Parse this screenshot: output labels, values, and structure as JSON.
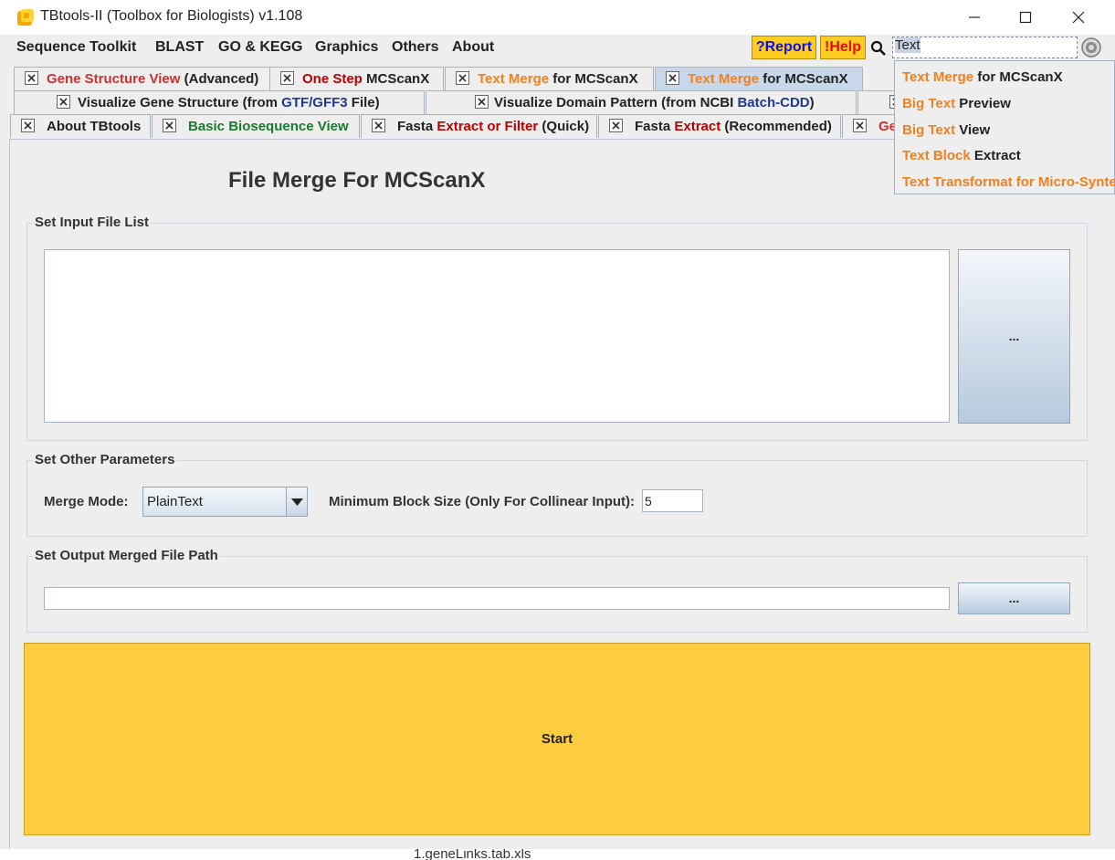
{
  "window": {
    "title": "TBtools-II (Toolbox for Biologists) v1.108"
  },
  "menu": {
    "items": [
      "Sequence Toolkit",
      "BLAST",
      "GO & KEGG",
      "Graphics",
      "Others",
      "About"
    ],
    "report_label": "?Report",
    "help_label": "!Help"
  },
  "search": {
    "value": "Text"
  },
  "tabs": {
    "row1": [
      {
        "parts": [
          [
            "Gene Structure View",
            "red"
          ],
          [
            " (Advanced)",
            "black"
          ]
        ]
      },
      {
        "parts": [
          [
            "One Step",
            "darkred"
          ],
          [
            " MCScanX",
            "black"
          ]
        ]
      },
      {
        "parts": [
          [
            "Text Merge",
            "orange"
          ],
          [
            " for MCScanX",
            "black"
          ]
        ]
      },
      {
        "parts": [
          [
            "Text Merge",
            "orange"
          ],
          [
            " for MCScanX",
            "black"
          ]
        ],
        "selected": true
      }
    ],
    "row2": [
      {
        "parts": [
          [
            "Visualize Gene Structure (from ",
            "black"
          ],
          [
            "GTF/GFF3",
            "blue"
          ],
          [
            " File)",
            "black"
          ]
        ]
      },
      {
        "parts": [
          [
            "Visualize Domain Pattern (from NCBI ",
            "black"
          ],
          [
            "Batch-CDD",
            "blue"
          ],
          [
            ")",
            "black"
          ]
        ]
      }
    ],
    "row3": [
      {
        "parts": [
          [
            "About TBtools",
            "black"
          ]
        ]
      },
      {
        "parts": [
          [
            "Basic Biosequence View",
            "green"
          ]
        ]
      },
      {
        "parts": [
          [
            "Fasta ",
            "black"
          ],
          [
            "Extract or Filter",
            "darkred"
          ],
          [
            " (Quick)",
            "black"
          ]
        ]
      },
      {
        "parts": [
          [
            "Fasta ",
            "black"
          ],
          [
            "Extract",
            "darkred"
          ],
          [
            " (Recommended)",
            "black"
          ]
        ]
      },
      {
        "parts": [
          [
            "Ge",
            "red"
          ]
        ]
      }
    ]
  },
  "page": {
    "title": "File Merge For MCScanX",
    "input_group_title": "Set Input File List",
    "input_browse_label": "...",
    "params_group_title": "Set Other Parameters",
    "merge_mode_label": "Merge Mode:",
    "merge_mode_value": "PlainText",
    "block_size_label": "Minimum Block Size (Only For Collinear Input):",
    "block_size_value": "5",
    "output_group_title": "Set Output Merged File Path",
    "output_path_value": "",
    "output_browse_label": "...",
    "start_label": "Start"
  },
  "dropdown": {
    "items": [
      [
        [
          "Text Merge",
          "orange"
        ],
        [
          " for MCScanX",
          "black"
        ]
      ],
      [
        [
          "Big Text",
          "orange"
        ],
        [
          " Preview",
          "black"
        ]
      ],
      [
        [
          "Big Text",
          "orange"
        ],
        [
          " View",
          "black"
        ]
      ],
      [
        [
          "Text Block",
          "orange"
        ],
        [
          " Extract",
          "black"
        ]
      ],
      [
        [
          "Text Transformat for Micro-Synte",
          "orange"
        ]
      ]
    ]
  },
  "background": {
    "file_text": "1.geneLinks.tab.xls"
  },
  "colors": {
    "accent_yellow": "#fecd40",
    "tab_selected": "#c8d8ea",
    "orange_text": "#f08020",
    "red_text": "#d03030"
  }
}
